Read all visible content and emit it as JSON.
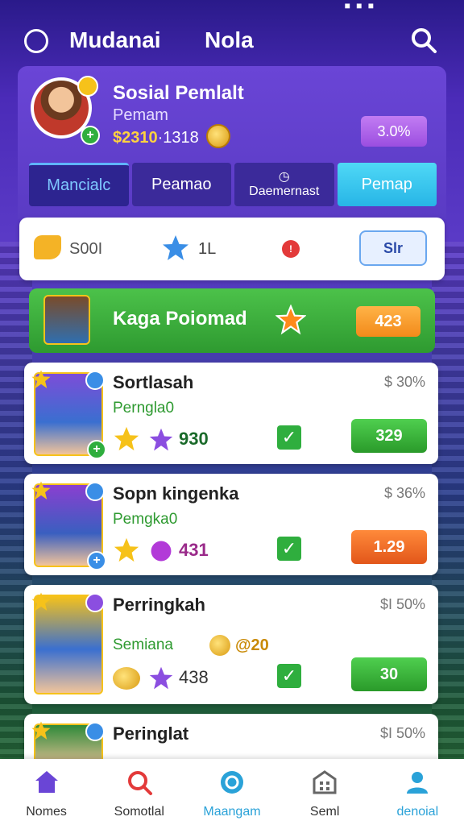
{
  "status": {
    "right_text": "■ ■ ■"
  },
  "header": {
    "title_left": "Mudanai",
    "title_right": "Nola"
  },
  "profile": {
    "name": "Sosial Pemlalt",
    "subtitle": "Pemam",
    "coins_highlight": "$2310",
    "coins_rest": "·1318",
    "badge": "3.0%"
  },
  "tabs": [
    {
      "label": "Mancialc"
    },
    {
      "label": "Peamao"
    },
    {
      "label": "Daemernast",
      "icon": "clock-icon"
    },
    {
      "label": "Pemap"
    }
  ],
  "stats": {
    "label1": "S00I",
    "label2": "1L",
    "dot": "!",
    "button": "Slr"
  },
  "highlight": {
    "title": "Kaga Poiomad",
    "button": "423"
  },
  "cards": [
    {
      "name": "Sortlasah",
      "sub": "Perngla0",
      "pct": "$ 30%",
      "score": "930",
      "button": "329",
      "btn_color": "green"
    },
    {
      "name": "Sopn kingenka",
      "sub": "Pemgka0",
      "pct": "$ 36%",
      "score": "431",
      "button": "1.29",
      "btn_color": "orange"
    },
    {
      "name": "Perringkah",
      "sub": "Semiana",
      "extra": "@20",
      "pct": "$I 50%",
      "score": "438",
      "button": "30",
      "btn_color": "green"
    },
    {
      "name": "Peringlat",
      "sub": "",
      "pct": "$I 50%",
      "score": "",
      "button": "",
      "btn_color": "green"
    }
  ],
  "bottom_nav": [
    {
      "label": "Nomes",
      "icon": "home-icon"
    },
    {
      "label": "Somotlal",
      "icon": "search-icon"
    },
    {
      "label": "Maangam",
      "icon": "chat-icon"
    },
    {
      "label": "Seml",
      "icon": "building-icon"
    },
    {
      "label": "denoial",
      "icon": "user-icon"
    }
  ],
  "colors": {
    "accent_purple": "#5a3bc4",
    "accent_green": "#2e9a30",
    "accent_orange": "#f28a1a",
    "accent_cyan": "#27b5e6"
  }
}
